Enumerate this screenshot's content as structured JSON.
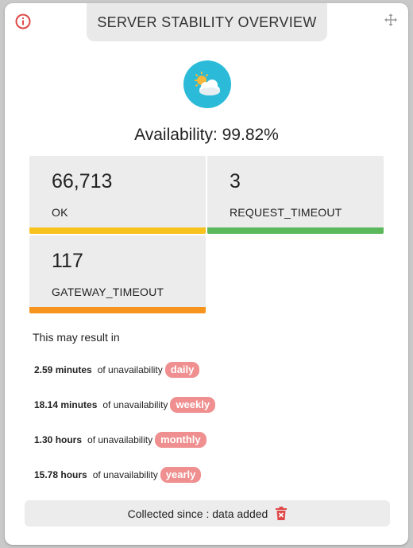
{
  "header": {
    "title": "SERVER STABILITY OVERVIEW",
    "info_icon": "info-icon",
    "move_icon": "move-icon"
  },
  "status_icon": "partly-cloudy-icon",
  "availability": "Availability: 99.82%",
  "tiles": [
    {
      "value": "66,713",
      "label": "OK",
      "color": "#f7c21e"
    },
    {
      "value": "3",
      "label": "REQUEST_TIMEOUT",
      "color": "#5cb85c"
    },
    {
      "value": "117",
      "label": "GATEWAY_TIMEOUT",
      "color": "#f7941e"
    }
  ],
  "result_intro": "This may result in",
  "unavailability": [
    {
      "amount": "2.59 minutes",
      "text": "of unavailability",
      "period": "daily"
    },
    {
      "amount": "18.14 minutes",
      "text": "of unavailability",
      "period": "weekly"
    },
    {
      "amount": "1.30 hours",
      "text": "of unavailability",
      "period": "monthly"
    },
    {
      "amount": "15.78 hours",
      "text": "of unavailability",
      "period": "yearly"
    }
  ],
  "footer": {
    "text": "Collected since : data added",
    "delete_icon": "trash-icon"
  },
  "colors": {
    "accent_circle": "#2bbbd8",
    "pill": "#ef8f8f",
    "info": "#e04848",
    "trash": "#e04848"
  }
}
